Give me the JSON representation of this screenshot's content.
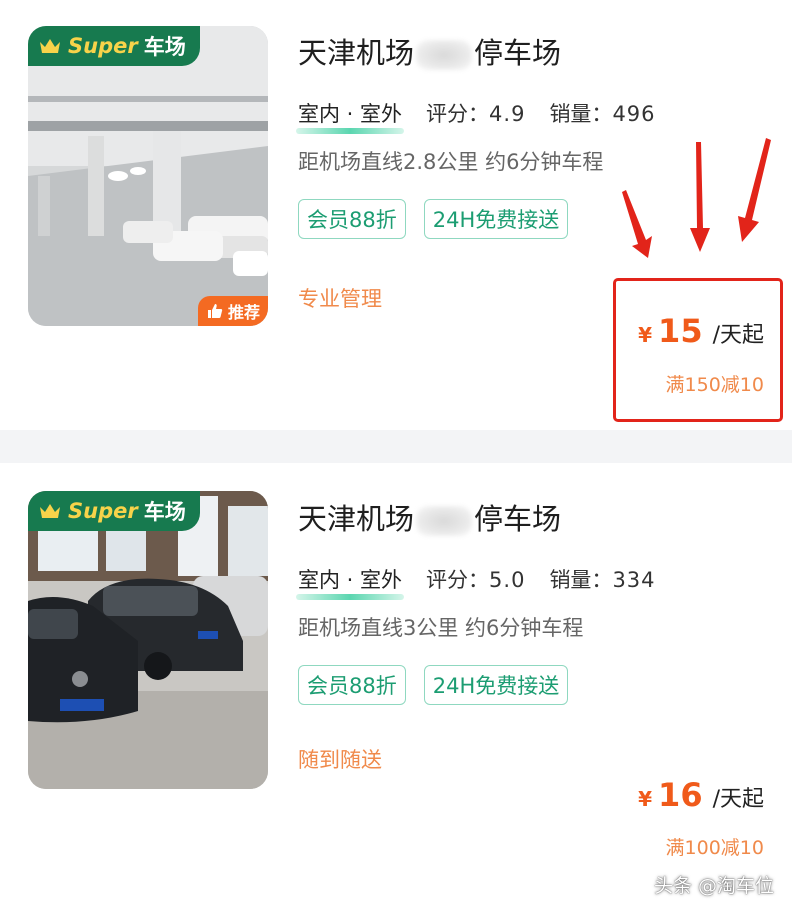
{
  "listings": [
    {
      "badge_en": "Super",
      "badge_cn": "车场",
      "recommend": "推荐",
      "title_start": "天津机场",
      "title_end": "停车场",
      "indoor_outdoor": "室内 · 室外",
      "rating_label": "评分：",
      "rating": "4.9",
      "sales_label": "销量：",
      "sales": "496",
      "distance": "距机场直线2.8公里 约6分钟车程",
      "tags": [
        "会员88折",
        "24H免费接送"
      ],
      "feature": "专业管理",
      "currency": "¥",
      "price": "15",
      "price_unit": "/天起",
      "discount": "满150减10"
    },
    {
      "badge_en": "Super",
      "badge_cn": "车场",
      "title_start": "天津机场",
      "title_end": "停车场",
      "indoor_outdoor": "室内 · 室外",
      "rating_label": "评分：",
      "rating": "5.0",
      "sales_label": "销量：",
      "sales": "334",
      "distance": "距机场直线3公里 约6分钟车程",
      "tags": [
        "会员88折",
        "24H免费接送"
      ],
      "feature": "随到随送",
      "currency": "¥",
      "price": "16",
      "price_unit": "/天起",
      "discount": "满100减10"
    }
  ],
  "watermark": "头条 @淘车位",
  "colors": {
    "brand_green": "#177a4f",
    "tag_green": "#1c9d72",
    "price_orange": "#f05a1a",
    "highlight_red": "#e2241a"
  },
  "icons": [
    "crown-icon",
    "thumbs-up-icon",
    "red-arrow-icon"
  ]
}
